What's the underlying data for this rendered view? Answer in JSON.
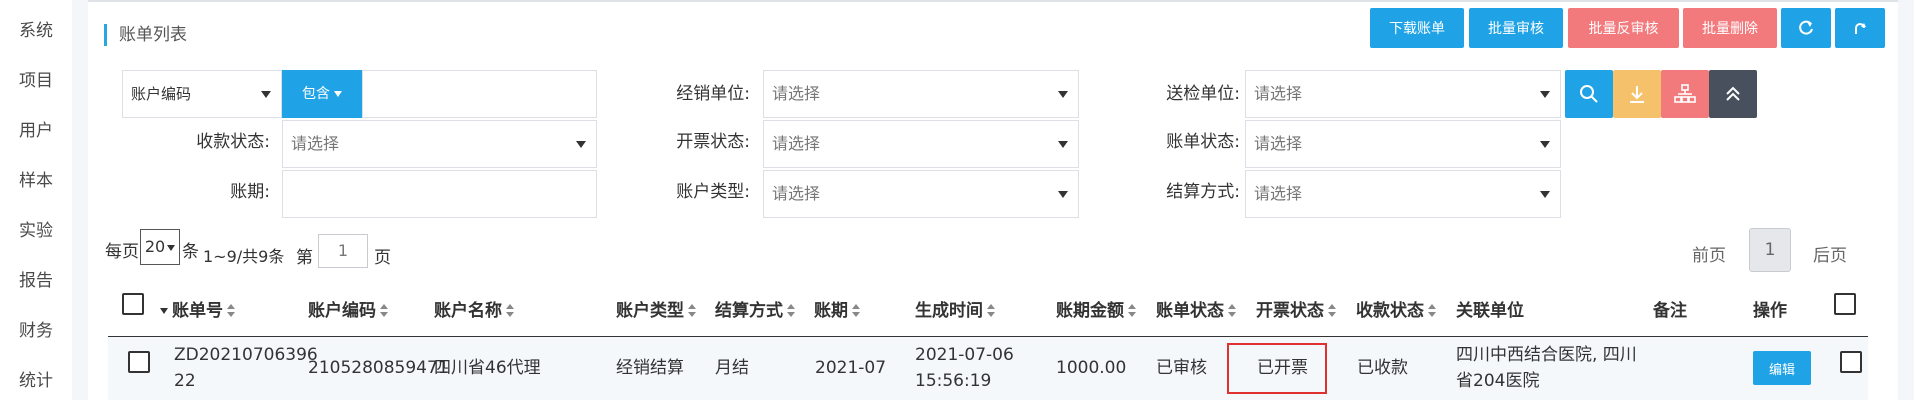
{
  "sidebar": {
    "items": [
      {
        "label": "系统"
      },
      {
        "label": "项目"
      },
      {
        "label": "用户"
      },
      {
        "label": "样本"
      },
      {
        "label": "实验"
      },
      {
        "label": "报告"
      },
      {
        "label": "财务"
      },
      {
        "label": "统计"
      }
    ]
  },
  "page": {
    "title": "账单列表"
  },
  "toolbar": {
    "download_bill": "下载账单",
    "batch_approve": "批量审核",
    "batch_unapprove": "批量反审核",
    "batch_delete": "批量删除"
  },
  "filters": {
    "account_field_select": "账户编码",
    "contains_label": "包含",
    "dealer_label": "经销单位:",
    "dealer_placeholder": "请选择",
    "sender_label": "送检单位:",
    "sender_placeholder": "请选择",
    "payment_status_label": "收款状态:",
    "payment_status_placeholder": "请选择",
    "invoice_status_label": "开票状态:",
    "invoice_status_placeholder": "请选择",
    "bill_status_label": "账单状态:",
    "bill_status_placeholder": "请选择",
    "period_label": "账期:",
    "account_type_label": "账户类型:",
    "account_type_placeholder": "请选择",
    "settlement_label": "结算方式:",
    "settlement_placeholder": "请选择"
  },
  "pagination": {
    "per_page_prefix": "每页",
    "per_page_value": "20",
    "per_page_suffix": "条",
    "range_text": "1~9/共9条",
    "page_prefix": "第",
    "page_value": "1",
    "page_suffix": "页",
    "prev": "前页",
    "current": "1",
    "next": "后页"
  },
  "table": {
    "columns": {
      "bill_no": "账单号",
      "account_code": "账户编码",
      "account_name": "账户名称",
      "account_type": "账户类型",
      "settlement": "结算方式",
      "period": "账期",
      "created": "生成时间",
      "amount": "账期金额",
      "bill_status": "账单状态",
      "invoice_status": "开票状态",
      "payment_status": "收款状态",
      "related_unit": "关联单位",
      "remark": "备注",
      "actions": "操作"
    },
    "rows": [
      {
        "bill_no_line1": "ZD20210706396",
        "bill_no_line2": "22",
        "account_code": "2105280859471",
        "account_name": "四川省46代理",
        "account_type": "经销结算",
        "settlement": "月结",
        "period": "2021-07",
        "created_line1": "2021-07-06",
        "created_line2": "15:56:19",
        "amount": "1000.00",
        "bill_status": "已审核",
        "invoice_status": "已开票",
        "payment_status": "已收款",
        "related_unit_line1": "四川中西结合医院, 四川",
        "related_unit_line2": "省204医院",
        "remark": "",
        "edit_label": "编辑"
      }
    ]
  },
  "colors": {
    "primary": "#1fa3e6",
    "danger": "#f27a7d",
    "warning": "#f6c16b",
    "dark": "#48505e",
    "highlight": "#e03030"
  }
}
